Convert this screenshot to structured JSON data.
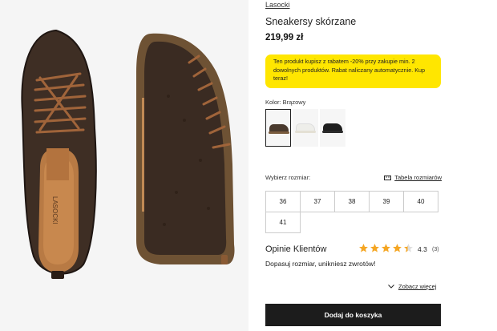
{
  "product": {
    "brand": "Lasocki",
    "title": "Sneakersy skórzane",
    "price": "219,99 zł",
    "promo": "Ten produkt kupisz z rabatem -20% przy zakupie min. 2 dowolnych produktów. Rabat naliczany automatycznie. Kup teraz!",
    "insole_text": "LASOCKI"
  },
  "color": {
    "label": "Kolor: Brązowy",
    "swatches": [
      {
        "name": "Brązowy",
        "shoe": "#4a3a2e",
        "sole": "#7a5c3e",
        "selected": true
      },
      {
        "name": "Biały",
        "shoe": "#eeeeea",
        "sole": "#e4e0d4",
        "selected": false
      },
      {
        "name": "Czarny",
        "shoe": "#1e1e1e",
        "sole": "#2a2a2a",
        "selected": false
      }
    ]
  },
  "sizes": {
    "label": "Wybierz rozmiar:",
    "guide": "Tabela rozmiarów",
    "row1": [
      "36",
      "37",
      "38",
      "39",
      "40"
    ],
    "row2": [
      "41"
    ]
  },
  "reviews": {
    "title": "Opinie Klientów",
    "rating": "4.3",
    "rating_value": 4.3,
    "count": "(3)",
    "fit_note": "Dopasuj rozmiar, unikniesz zwrotów!",
    "see_more": "Zobacz więcej"
  },
  "cart": {
    "button": "Dodaj do koszyka"
  },
  "colors": {
    "accent_yellow": "#ffe600",
    "button_dark": "#1c1c1c",
    "star": "#f5a623"
  }
}
